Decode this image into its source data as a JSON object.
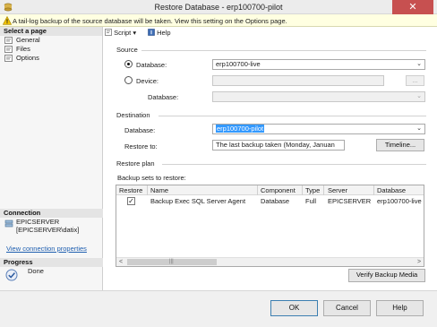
{
  "window": {
    "title": "Restore Database - erp100700-pilot",
    "close_glyph": "✕"
  },
  "infobar": {
    "message": "A tail-log backup of the source database will be taken. View this setting on the Options page.",
    "icon": "warning-icon"
  },
  "left": {
    "select_page_header": "Select a page",
    "pages": [
      "General",
      "Files",
      "Options"
    ],
    "connection_header": "Connection",
    "server": "EPICSERVER",
    "user": "[EPICSERVER\\datix]",
    "view_connection_link": "View connection properties",
    "progress_header": "Progress",
    "progress_status": "Done"
  },
  "toolbar": {
    "script_label": "Script",
    "script_dropdown": "▾",
    "help_label": "Help"
  },
  "source": {
    "header": "Source",
    "database_radio_label": "Database:",
    "database_value": "erp100700-live",
    "device_radio_label": "Device:",
    "device_value": "",
    "device_browse_label": "...",
    "device_database_label": "Database:",
    "device_database_value": "",
    "selected": "database"
  },
  "destination": {
    "header": "Destination",
    "database_label": "Database:",
    "database_value": "erp100700-pilot",
    "restore_to_label": "Restore to:",
    "restore_to_value": "The last backup taken (Monday, Januan",
    "timeline_button": "Timeline..."
  },
  "restore_plan": {
    "header": "Restore plan",
    "backup_sets_label": "Backup sets to restore:",
    "columns": [
      "Restore",
      "Name",
      "Component",
      "Type",
      "Server",
      "Database"
    ],
    "rows": [
      {
        "restore": true,
        "name": "Backup Exec SQL Server Agent",
        "component": "Database",
        "type": "Full",
        "server": "EPICSERVER",
        "database": "erp100700-live"
      }
    ],
    "scroll_left": "<",
    "scroll_right": ">",
    "scroll_grip": "|||",
    "verify_button": "Verify Backup Media"
  },
  "buttons": {
    "ok": "OK",
    "cancel": "Cancel",
    "help": "Help"
  },
  "dropdown_arrow": "⌄",
  "check_glyph": "✓"
}
